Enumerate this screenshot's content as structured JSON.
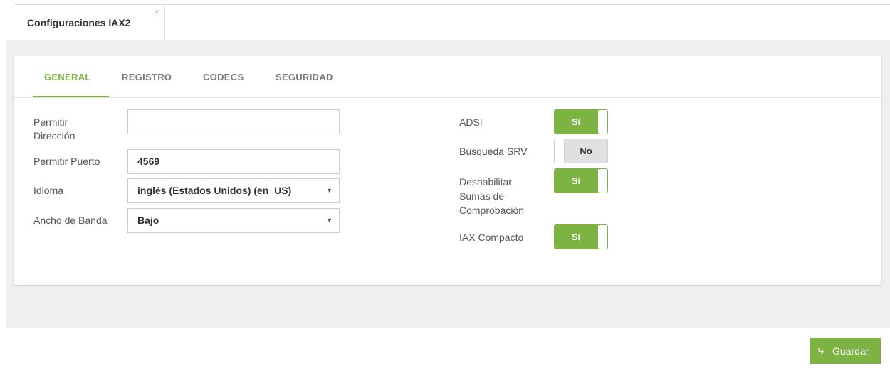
{
  "doc_tab": {
    "title": "Configuraciones IAX2",
    "close": "×"
  },
  "tabs": [
    {
      "label": "GENERAL",
      "active": true
    },
    {
      "label": "REGISTRO",
      "active": false
    },
    {
      "label": "CODECS",
      "active": false
    },
    {
      "label": "SEGURIDAD",
      "active": false
    }
  ],
  "left_form": {
    "permit_address": {
      "label_line1": "Permitir",
      "label_line2": "Dirección",
      "value": ""
    },
    "permit_port": {
      "label": "Permitir Puerto",
      "value": "4569"
    },
    "language": {
      "label": "Idioma",
      "value": "inglés (Estados Unidos) (en_US)"
    },
    "bandwidth": {
      "label": "Ancho de Banda",
      "value": "Bajo"
    }
  },
  "right_form": {
    "adsi": {
      "label": "ADSI",
      "state": "on",
      "state_label": "Sí"
    },
    "srv_lookup": {
      "label": "Búsqueda SRV",
      "state": "off",
      "state_label": "No"
    },
    "disable_checksums": {
      "label_line1": "Deshabilitar",
      "label_line2": "Sumas de",
      "label_line3": "Comprobación",
      "state": "on",
      "state_label": "Sí"
    },
    "compact_iax": {
      "label": "IAX Compacto",
      "state": "on",
      "state_label": "Sí"
    }
  },
  "select_arrow": "▼",
  "save_button": {
    "label": "Guardar",
    "icon": "save-arrow-icon"
  },
  "colors": {
    "accent": "#7cb342",
    "page_bg": "#efefef"
  }
}
